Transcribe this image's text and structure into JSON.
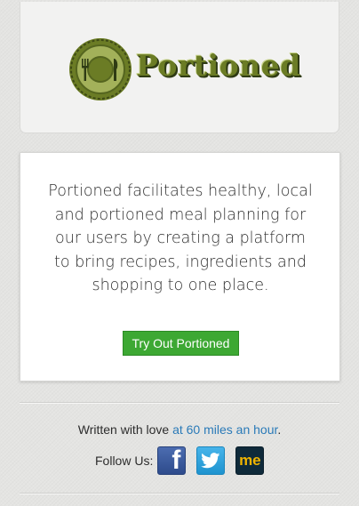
{
  "brand": {
    "name": "Portioned",
    "accent_color": "#6b7c25"
  },
  "intro": {
    "description": "Portioned facilitates healthy, local and portioned meal planning for our users by creating a platform to bring recipes, ingredients and shopping to one place.",
    "cta_label": "Try Out Portioned",
    "cta_color": "#3da833"
  },
  "footer": {
    "written_prefix": "Written with love ",
    "written_link": "at 60 miles an hour",
    "written_suffix": ".",
    "link_color": "#2a7ab8",
    "follow_label": "Follow Us:",
    "social": [
      {
        "name": "facebook",
        "icon": "facebook-icon",
        "glyph": "f"
      },
      {
        "name": "twitter",
        "icon": "twitter-icon",
        "glyph": ""
      },
      {
        "name": "about.me",
        "icon": "aboutme-icon",
        "glyph": "me"
      }
    ]
  }
}
